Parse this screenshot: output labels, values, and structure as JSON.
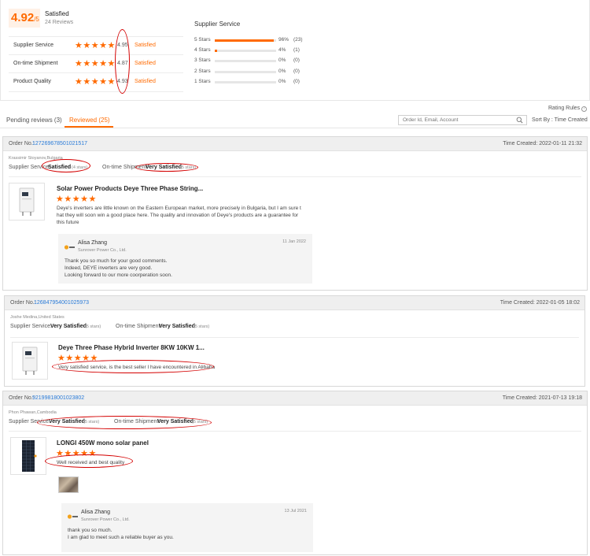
{
  "summary": {
    "score": "4.92",
    "score_suffix": "/5",
    "label": "Satisfied",
    "reviews_count": "24 Reviews",
    "metrics": [
      {
        "name": "Supplier Service",
        "stars": "★★★★★",
        "value": "4.95",
        "label": "Satisfied"
      },
      {
        "name": "On-time Shipment",
        "stars": "★★★★★",
        "value": "4.87",
        "label": "Satisfied"
      },
      {
        "name": "Product Quality",
        "stars": "★★★★★",
        "value": "4.93",
        "label": "Satisfied"
      }
    ]
  },
  "distribution": {
    "title": "Supplier Service",
    "rows": [
      {
        "label": "5 Stars",
        "fill": 0.96,
        "percent": "96%",
        "count": "(23)"
      },
      {
        "label": "4 Stars",
        "fill": 0.04,
        "percent": "4%",
        "count": "(1)"
      },
      {
        "label": "3 Stars",
        "fill": 0,
        "percent": "0%",
        "count": "(0)"
      },
      {
        "label": "2 Stars",
        "fill": 0,
        "percent": "0%",
        "count": "(0)"
      },
      {
        "label": "1 Stars",
        "fill": 0,
        "percent": "0%",
        "count": "(0)"
      }
    ]
  },
  "toolbar": {
    "rating_rules": "Rating Rules",
    "tabs": [
      "Pending reviews (3)",
      "Reviewed (25)"
    ],
    "search_placeholder": "Order Id, Email, Account",
    "sort": "Sort By : Time Created"
  },
  "reviews": [
    {
      "order_label": "Order No.:",
      "order_no": "127269678501021517",
      "time": "Time Created: 2022-01-11 21:32",
      "buyer": "Krassimir Stoyanov,Bulgaria",
      "supplier_label": "Supplier Service:",
      "supplier_value": "Satisfied",
      "supplier_stars": "(4 stars)",
      "shipment_label": "On-time Shipment:",
      "shipment_value": "Very Satisfied",
      "shipment_stars": "(5 stars)",
      "product": "Solar Power Products Deye Three Phase String...",
      "stars": "★★★★★",
      "comment_lines": [
        "Deye's inverters are little known on the Eastern European market, more precisely in Bulgaria, but I am sure t",
        "hat they will soon win a good place here. The quality and innovation of Deye's products are a guarantee for",
        "this future"
      ],
      "reply": {
        "name": "Alisa Zhang",
        "company": "Sunrover Power Co., Ltd.",
        "date": "11 Jan 2022",
        "lines": [
          "Thank you so much for your good comments.",
          "Indeed, DEYE inverters are very good.",
          "Looking forward to our more coorperation soon."
        ]
      }
    },
    {
      "order_label": "Order No.:",
      "order_no": "126847954001025973",
      "time": "Time Created: 2022-01-05 18:02",
      "buyer": "Joshe Medina,United States",
      "supplier_label": "Supplier Service:",
      "supplier_value": "Very Satisfied",
      "supplier_stars": "(5 stars)",
      "shipment_label": "On-time Shipment:",
      "shipment_value": "Very Satisfied",
      "shipment_stars": "(5 stars)",
      "product": "Deye Three Phase Hybrid Inverter 8KW 10KW 1...",
      "stars": "★★★★★",
      "comment_lines": [
        "Very satisfied service, is the best seller I have encountered in Alibaba"
      ]
    },
    {
      "order_label": "Order No.:",
      "order_no": "92199818001023802",
      "time": "Time Created: 2021-07-13 19:18",
      "buyer": "Phon Phawan,Cambodia",
      "supplier_label": "Supplier Service:",
      "supplier_value": "Very Satisfied",
      "supplier_stars": "(5 stars)",
      "shipment_label": "On-time Shipment:",
      "shipment_value": "Very Satisfied",
      "shipment_stars": "(5 stars)",
      "product": "LONGI 450W mono solar panel",
      "stars": "★★★★★",
      "comment_lines": [
        "Well received and best quality"
      ],
      "reply": {
        "name": "Alisa Zhang",
        "company": "Sunrover Power Co., Ltd.",
        "date": "13 Jul 2021",
        "lines": [
          "thank you so much.",
          "I am glad to meet such a reliable buyer as you."
        ]
      }
    }
  ],
  "colors": {
    "accent": "#ff6a00",
    "link": "#2a7bd8",
    "annotation": "#d40000"
  }
}
